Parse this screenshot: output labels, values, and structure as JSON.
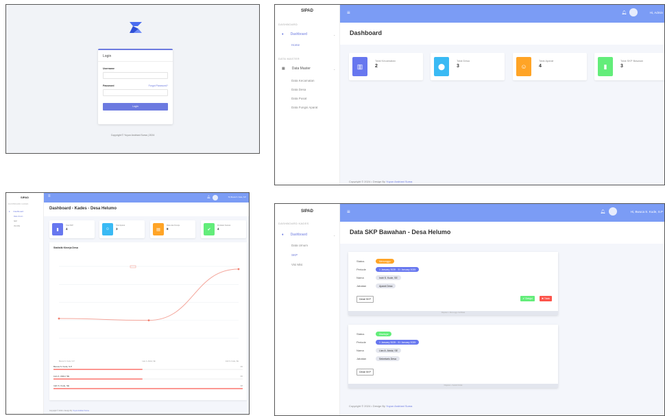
{
  "login": {
    "title": "Login",
    "username_label": "Username",
    "password_label": "Password",
    "forgot_label": "Forgot Password?",
    "button_label": "Login",
    "copyright": "Copyright © Yuyun Andriani Suma | 2024"
  },
  "admin": {
    "brand": "SIPAD",
    "user_label": "Hi, Admin",
    "menu_dashboard_label": "DASHBOARD",
    "nav_dashboard": "Dashboard",
    "nav_home": "Home",
    "menu_data_label": "DATA MASTER",
    "nav_data_master": "Data Master",
    "sub_items": [
      "Data Kecamatan",
      "Data Desa",
      "Data Pusat",
      "Data Fungsi Aparat"
    ],
    "page_title": "Dashboard",
    "stats": [
      {
        "label": "Total Kecamatan",
        "value": "2",
        "color": "#6777ef",
        "icon": "building-icon"
      },
      {
        "label": "Total Desa",
        "value": "3",
        "color": "#3abaf4",
        "icon": "map-pin-icon"
      },
      {
        "label": "Total Aparat",
        "value": "4",
        "color": "#ffa426",
        "icon": "user-icon"
      },
      {
        "label": "Total SKP Bawaan",
        "value": "3",
        "color": "#63ed7a",
        "icon": "file-icon"
      }
    ],
    "footer_prefix": "Copyright © 2024 •  Design By ",
    "footer_author": "Yuyun Andriani Suma"
  },
  "kades": {
    "brand": "SIPAD",
    "user_label": "Hi, Bwuca S. Kude, S.P",
    "menu_label": "DASHBOARD KADES",
    "nav_dashboard": "Dashboard",
    "sub_items": [
      "Data Umum",
      "SKP",
      "Visi Misi"
    ],
    "page_title": "Dashboard - Kades - Desa Helumo",
    "stats": [
      {
        "label": "Total SKP",
        "value": "4",
        "color": "#6777ef",
        "icon": "file-icon"
      },
      {
        "label": "Total Aparat",
        "value": "3",
        "color": "#3abaf4",
        "icon": "user-icon"
      },
      {
        "label": "Rata-rata Kinerja",
        "value": "8",
        "color": "#ffa426",
        "icon": "chart-icon"
      },
      {
        "label": "Penilaian Selesai",
        "value": "4",
        "color": "#63ed7a",
        "icon": "check-icon"
      }
    ],
    "chart_title": "Statistik Kinerja Desa",
    "footer_prefix": "Copyright © 2024 •  Design By ",
    "footer_author": "Yuyun Andriani Suma",
    "chart_data": {
      "type": "line",
      "title": "Statistik Kinerja Desa",
      "categories": [
        "Bwuca S. Kude, S.P",
        "Lian A. Abdul, SE",
        "Indri S. Kude, SE"
      ],
      "series": [
        {
          "name": "",
          "values": [
            42,
            40,
            97
          ]
        }
      ],
      "ylim": [
        0,
        110
      ],
      "grid": true,
      "rows": [
        {
          "name": "Bwuca S. Kude, S.P",
          "value": "40",
          "fill": 0.47
        },
        {
          "name": "Lian A. Abdul, SE",
          "value": "40",
          "fill": 0.47
        },
        {
          "name": "Indri S. Kude, SE",
          "value": "98",
          "fill": 1.0
        }
      ]
    }
  },
  "skp": {
    "brand": "SIPAD",
    "user_label": "Hi, Bwuca S. Kude, S.P",
    "menu_label": "DASHBOARD KADES",
    "nav_dashboard": "Dashboard",
    "sub_items": [
      "Data Umum",
      "SKP",
      "Visi Misi"
    ],
    "page_title": "Data SKP Bawahan - Desa Helumo",
    "label_status": "Status",
    "label_periode": "Periode",
    "label_nama": "Nama",
    "label_jabatan": "Jabatan",
    "detail_label": "Detail SKP",
    "approve_label": "✔ Setujui",
    "reject_label": "✖ Tolak",
    "cards": [
      {
        "status": "Menunggu",
        "status_color": "#ffa426",
        "periode": "1 January 2025 - 31 January 2025",
        "nama": "Indri S. Kude, SE",
        "jabatan": "Aparat Desa",
        "foot": "Diajukan • Menunggu Verifikasi"
      },
      {
        "status": "Disetujui",
        "status_color": "#63ed7a",
        "periode": "1 January 2025 - 31 January 2025",
        "nama": "Lian A. Abdul, SE",
        "jabatan": "Sekretaris Desa",
        "foot": "Diajukan • Sudah Dinilai"
      }
    ],
    "footer_prefix": "Copyright © 2024 •  Design By ",
    "footer_author": "Yuyun Andriani Suma"
  }
}
